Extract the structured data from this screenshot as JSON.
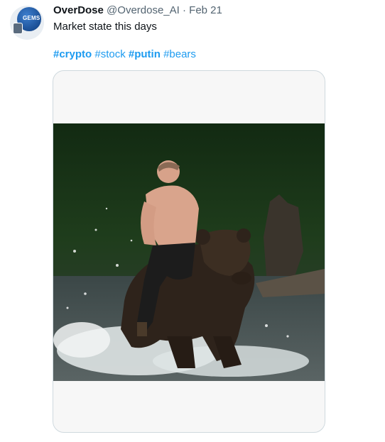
{
  "tweet": {
    "display_name": "OverDose",
    "handle": "@Overdose_AI",
    "separator": "·",
    "date": "Feb 21",
    "text": "Market state this days",
    "hashtags": [
      {
        "label": "#crypto",
        "bold": true
      },
      {
        "label": "#stock",
        "bold": false
      },
      {
        "label": "#putin",
        "bold": true
      },
      {
        "label": "#bears",
        "bold": false
      }
    ]
  },
  "avatar": {
    "logo_text": "GEMS",
    "icon": "robot-logo-icon"
  },
  "media": {
    "icon": "photo-man-riding-bear"
  },
  "colors": {
    "link": "#1d9bf0",
    "muted": "#536471",
    "text": "#0f1419",
    "border": "#cfd9de"
  }
}
